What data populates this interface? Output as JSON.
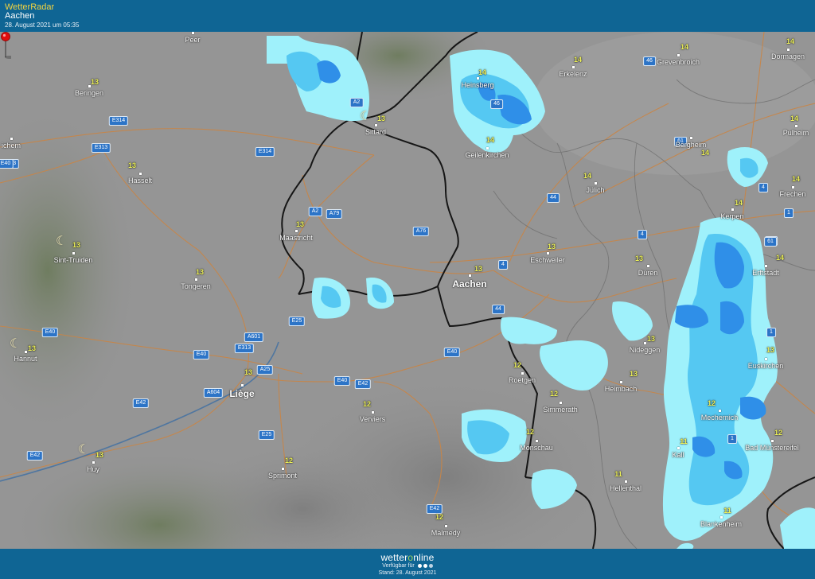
{
  "header": {
    "app_title": "WetterRadar",
    "city": "Aachen",
    "timestamp": "28. August 2021 um 05:35"
  },
  "footer": {
    "brand_prefix": "wetter",
    "brand_o": "o",
    "brand_suffix": "nline",
    "availability": "Verfügbar für",
    "stand": "Stand: 28. August 2021"
  },
  "colors": {
    "header_bg": "#0f6594",
    "app_title": "#f2d341",
    "rain_light": "#9ff1fb",
    "rain_medium": "#55c8f2",
    "rain_heavy": "#2f8fe8",
    "temperature": "#eef25a",
    "road_badge": "#2c74c7",
    "border": "#1a1a1a"
  },
  "places": [
    {
      "name": "Peer",
      "temp": ""
    },
    {
      "name": "Beringen",
      "temp": "13"
    },
    {
      "name": "ichem",
      "temp": ""
    },
    {
      "name": "Hasselt",
      "temp": "13"
    },
    {
      "name": "Sint-Truiden",
      "temp": "13"
    },
    {
      "name": "Tongeren",
      "temp": "13"
    },
    {
      "name": "Hannut",
      "temp": "13"
    },
    {
      "name": "Huy",
      "temp": "13"
    },
    {
      "name": "Liège",
      "temp": "13"
    },
    {
      "name": "Sprimont",
      "temp": "12"
    },
    {
      "name": "Verviers",
      "temp": "12"
    },
    {
      "name": "Malmedy",
      "temp": "12"
    },
    {
      "name": "Maastricht",
      "temp": "13"
    },
    {
      "name": "Sittard",
      "temp": "13"
    },
    {
      "name": "Heinsberg",
      "temp": "14"
    },
    {
      "name": "Geilenkirchen",
      "temp": "14"
    },
    {
      "name": "Erkelenz",
      "temp": "14"
    },
    {
      "name": "Grevenbroich",
      "temp": "14"
    },
    {
      "name": "Dormagen",
      "temp": "14"
    },
    {
      "name": "Pulheim",
      "temp": "14"
    },
    {
      "name": "Bergheim",
      "temp": "14"
    },
    {
      "name": "Jülich",
      "temp": "14"
    },
    {
      "name": "Frechen",
      "temp": "14"
    },
    {
      "name": "Kerpen",
      "temp": "14"
    },
    {
      "name": "Erftstadt",
      "temp": "14"
    },
    {
      "name": "Eschweiler",
      "temp": "13"
    },
    {
      "name": "Aachen",
      "temp": "13"
    },
    {
      "name": "Düren",
      "temp": "13"
    },
    {
      "name": "Nideggen",
      "temp": "13"
    },
    {
      "name": "Euskirchen",
      "temp": "13"
    },
    {
      "name": "Roetgen",
      "temp": "12"
    },
    {
      "name": "Heimbach",
      "temp": "13"
    },
    {
      "name": "Simmerath",
      "temp": "12"
    },
    {
      "name": "Mechernich",
      "temp": "12"
    },
    {
      "name": "Monschau",
      "temp": "12"
    },
    {
      "name": "Kall",
      "temp": "11"
    },
    {
      "name": "Bad Münstereifel",
      "temp": "12"
    },
    {
      "name": "Hellenthal",
      "temp": "11"
    },
    {
      "name": "Blankenheim",
      "temp": "11"
    }
  ],
  "roads": [
    "E314",
    "E313",
    "E314",
    "E313",
    "A2",
    "A79",
    "A76",
    "E25",
    "A601",
    "E313",
    "E40",
    "E40",
    "A25",
    "A604",
    "E42",
    "E40",
    "E42",
    "E40",
    "E25",
    "E42",
    "E42",
    "61",
    "46",
    "46",
    "61",
    "44",
    "4",
    "4",
    "44",
    "4",
    "1",
    "61",
    "1",
    "1",
    "A2",
    "E40"
  ]
}
